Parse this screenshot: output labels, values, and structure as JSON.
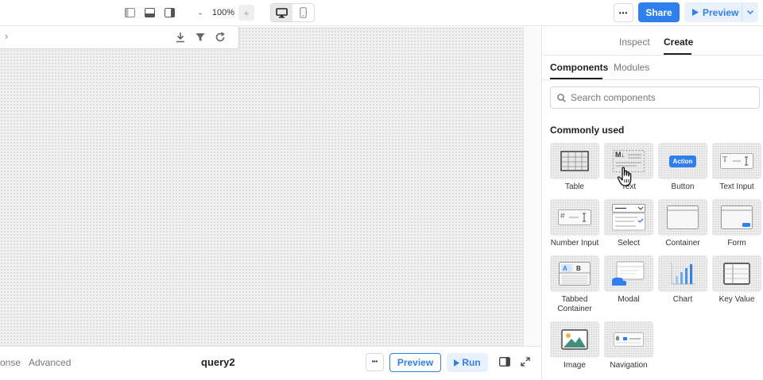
{
  "toolbar": {
    "zoom": "100%",
    "zoom_minus": "-",
    "zoom_plus": "+",
    "more": "•••",
    "share": "Share",
    "preview": "Preview"
  },
  "canvas": {
    "table_chevron": "›"
  },
  "bottom": {
    "tab_response": "onse",
    "tab_advanced": "Advanced",
    "query_name": "query2",
    "more": "•••",
    "preview": "Preview",
    "run": "Run"
  },
  "panel": {
    "tab_inspect": "Inspect",
    "tab_create": "Create",
    "sub_components": "Components",
    "sub_modules": "Modules",
    "search_placeholder": "Search components",
    "section_title": "Commonly used",
    "components": [
      {
        "label": "Table",
        "icon": "table-icon"
      },
      {
        "label": "Text",
        "icon": "markdown-text-icon"
      },
      {
        "label": "Button",
        "icon": "button-icon"
      },
      {
        "label": "Text Input",
        "icon": "text-input-icon"
      },
      {
        "label": "Number Input",
        "icon": "number-input-icon"
      },
      {
        "label": "Select",
        "icon": "select-icon"
      },
      {
        "label": "Container",
        "icon": "container-icon"
      },
      {
        "label": "Form",
        "icon": "form-icon"
      },
      {
        "label": "Tabbed Container",
        "icon": "tabbed-container-icon"
      },
      {
        "label": "Modal",
        "icon": "modal-icon"
      },
      {
        "label": "Chart",
        "icon": "chart-icon"
      },
      {
        "label": "Key Value",
        "icon": "key-value-icon"
      },
      {
        "label": "Image",
        "icon": "image-icon"
      },
      {
        "label": "Navigation",
        "icon": "navigation-icon"
      }
    ],
    "button_thumb_text": "Action",
    "text_thumb_glyph": "M↓",
    "tabbed_thumb_a": "A",
    "tabbed_thumb_b": "B",
    "input_thumb_glyph": "T",
    "number_thumb_glyph": "#"
  },
  "colors": {
    "accent": "#2f80ed",
    "accent_light": "#e9f1fd"
  }
}
